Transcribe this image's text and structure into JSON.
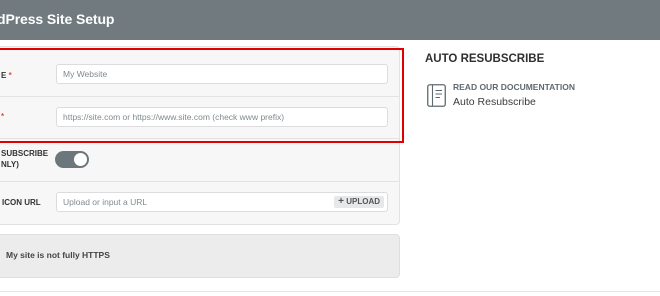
{
  "header": {
    "title": "dPress Site Setup"
  },
  "form": {
    "site_name": {
      "label_suffix": "E",
      "placeholder": "My Website"
    },
    "site_url": {
      "placeholder": "https://site.com or https://www.site.com (check www prefix)"
    },
    "auto_resubscribe": {
      "label_line1": "SUBSCRIBE",
      "label_line2": "NLY)",
      "enabled": true
    },
    "icon_url": {
      "label": "ICON URL",
      "placeholder": "Upload or input a URL",
      "upload_label": "UPLOAD"
    }
  },
  "notice": {
    "text": "My site is not fully HTTPS"
  },
  "sidebar": {
    "heading": "AUTO RESUBSCRIBE",
    "doc_title": "READ OUR DOCUMENTATION",
    "doc_subtitle": "Auto Resubscribe"
  },
  "colors": {
    "header_bg": "#717a7f",
    "highlight_border": "#e00000",
    "required": "#e14d43",
    "toggle_on": "#6b777d"
  }
}
